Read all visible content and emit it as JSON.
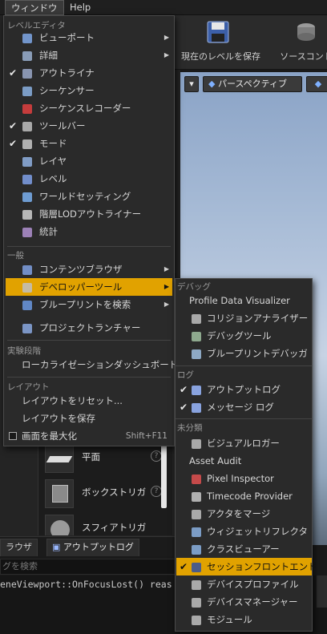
{
  "menubar": {
    "window": "ウィンドウ",
    "help": "Help"
  },
  "toolbar": {
    "save_current_level": "現在のレベルを保存",
    "source_control": "ソースコント"
  },
  "viewport": {
    "perspective": "パースペクティブ"
  },
  "content_items": [
    {
      "label": "平面",
      "help": "?"
    },
    {
      "label": "ボックストリガ",
      "help": "?"
    },
    {
      "label": "スフィアトリガ",
      "help": "?"
    }
  ],
  "bottom_tabs": {
    "browser": "ラウザ",
    "output_log": "アウトプットログ"
  },
  "search_placeholder": "グを検索",
  "log_line": "eneViewport::OnFocusLost() reas",
  "menu": {
    "section_level_editor": "レベルエディタ",
    "items_level": [
      {
        "label": "ビューポート",
        "icon": "viewport-icon",
        "checked": false,
        "arrow": true
      },
      {
        "label": "詳細",
        "icon": "details-icon",
        "checked": false,
        "arrow": true
      },
      {
        "label": "アウトライナ",
        "icon": "outliner-icon",
        "checked": true,
        "arrow": false
      },
      {
        "label": "シーケンサー",
        "icon": "sequencer-icon",
        "checked": false,
        "arrow": false
      },
      {
        "label": "シーケンスレコーダー",
        "icon": "recorder-icon",
        "checked": false,
        "arrow": false
      },
      {
        "label": "ツールバー",
        "icon": "toolbar-icon",
        "checked": true,
        "arrow": false
      },
      {
        "label": "モード",
        "icon": "modes-icon",
        "checked": true,
        "arrow": false
      },
      {
        "label": "レイヤ",
        "icon": "layers-icon",
        "checked": false,
        "arrow": false
      },
      {
        "label": "レベル",
        "icon": "levels-icon",
        "checked": false,
        "arrow": false
      },
      {
        "label": "ワールドセッティング",
        "icon": "world-settings-icon",
        "checked": false,
        "arrow": false
      },
      {
        "label": "階層LODアウトライナー",
        "icon": "hlod-icon",
        "checked": false,
        "arrow": false
      },
      {
        "label": "統計",
        "icon": "statistics-icon",
        "checked": false,
        "arrow": false
      }
    ],
    "section_general": "一般",
    "items_general": [
      {
        "label": "コンテンツブラウザ",
        "icon": "content-browser-icon",
        "arrow": true
      },
      {
        "label": "デベロッパーツール",
        "icon": "developer-tools-icon",
        "arrow": true
      },
      {
        "label": "ブループリントを検索",
        "icon": "find-blueprint-icon",
        "arrow": true
      },
      {
        "label": "プロジェクトランチャー",
        "icon": "project-launcher-icon",
        "arrow": false
      }
    ],
    "section_experimental": "実験段階",
    "localization_dashboard": "ローカライゼーションダッシュボード",
    "section_layout": "レイアウト",
    "reset_layout": "レイアウトをリセット...",
    "save_layout": "レイアウトを保存",
    "maximize": "画面を最大化",
    "maximize_shortcut": "Shift+F11"
  },
  "submenu": {
    "section_debug": "デバッグ",
    "profile_data_visualizer": "Profile Data Visualizer",
    "items_debug": [
      {
        "label": "コリジョンアナライザー",
        "icon": "collision-analyzer-icon"
      },
      {
        "label": "デバッグツール",
        "icon": "debug-tools-icon"
      },
      {
        "label": "ブループリントデバッガ",
        "icon": "blueprint-debugger-icon"
      }
    ],
    "section_log": "ログ",
    "items_log": [
      {
        "label": "アウトプットログ",
        "icon": "output-log-icon",
        "checked": true
      },
      {
        "label": "メッセージ ログ",
        "icon": "message-log-icon",
        "checked": true
      }
    ],
    "section_misc": "未分類",
    "visual_logger": "ビジュアルロガー",
    "asset_audit": "Asset Audit",
    "items_misc": [
      {
        "label": "Pixel Inspector",
        "icon": "pixel-inspector-icon",
        "checked": false
      },
      {
        "label": "Timecode Provider",
        "icon": "timecode-icon",
        "checked": false
      },
      {
        "label": "アクタをマージ",
        "icon": "merge-actors-icon",
        "checked": false
      },
      {
        "label": "ウィジェットリフレクタ",
        "icon": "widget-reflector-icon",
        "checked": false
      },
      {
        "label": "クラスビューアー",
        "icon": "class-viewer-icon",
        "checked": false
      },
      {
        "label": "セッションフロントエンド",
        "icon": "session-frontend-icon",
        "checked": true
      },
      {
        "label": "デバイスプロファイル",
        "icon": "device-profiles-icon",
        "checked": false
      },
      {
        "label": "デバイスマネージャー",
        "icon": "device-manager-icon",
        "checked": false
      },
      {
        "label": "モジュール",
        "icon": "modules-icon",
        "checked": false
      }
    ]
  },
  "colors": {
    "highlight": "#e1a200",
    "menu_bg": "#2a2a2a"
  }
}
